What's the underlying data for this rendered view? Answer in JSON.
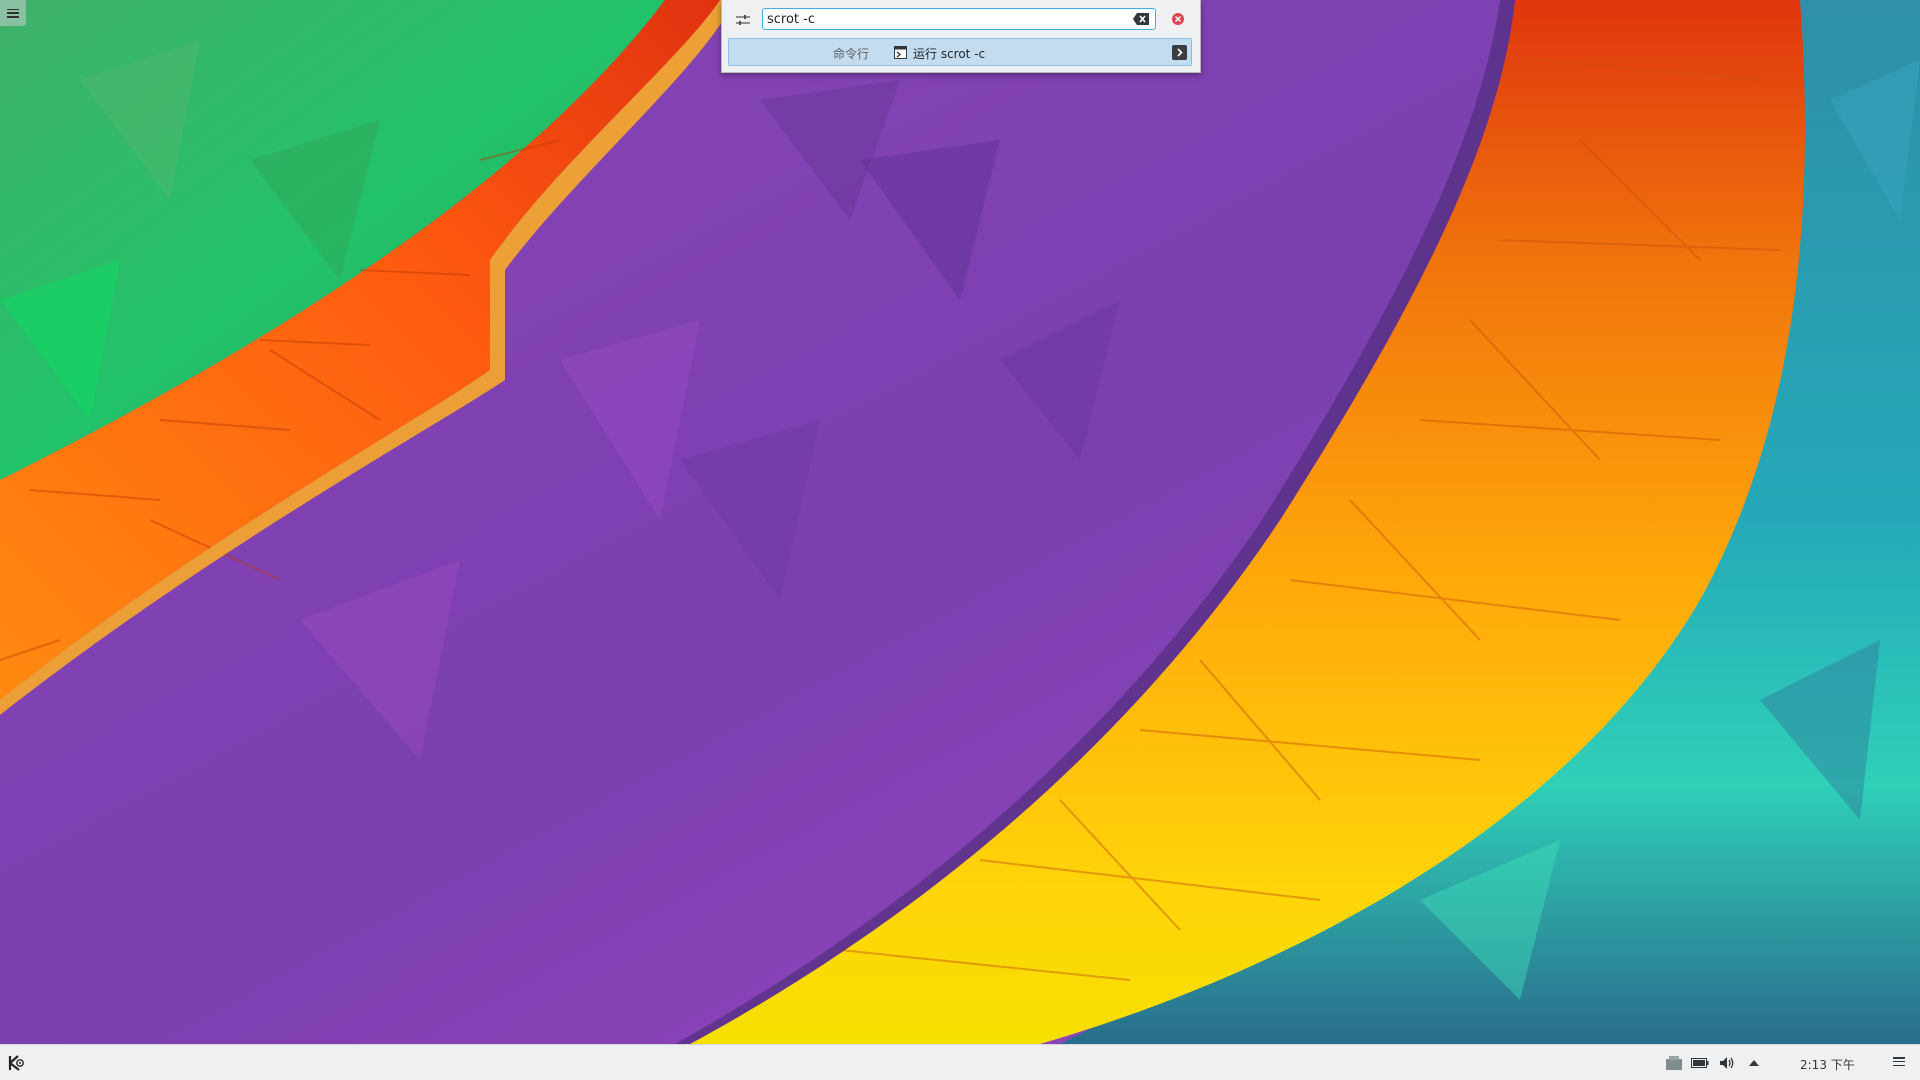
{
  "krunner": {
    "query": "scrot -c",
    "result": {
      "category": "命令行",
      "label": "运行 scrot -c"
    }
  },
  "panel": {
    "clock": "2:13 下午"
  },
  "icons": {
    "desktop_toolbox": "hamburger-menu-icon",
    "krunner_config": "sliders-config-icon",
    "clear": "backspace-clear-icon",
    "close": "close-circle-icon",
    "run": "terminal-run-icon",
    "result_action": "chevron-right-icon",
    "launcher": "kde-logo-icon",
    "tray": [
      "device-notifier-icon",
      "battery-icon",
      "volume-icon",
      "expand-tray-icon"
    ],
    "panel_options": "hamburger-menu-icon"
  },
  "colors": {
    "accent": "#3daee9",
    "panel_bg": "#eff0f1",
    "close_red": "#da4453"
  }
}
